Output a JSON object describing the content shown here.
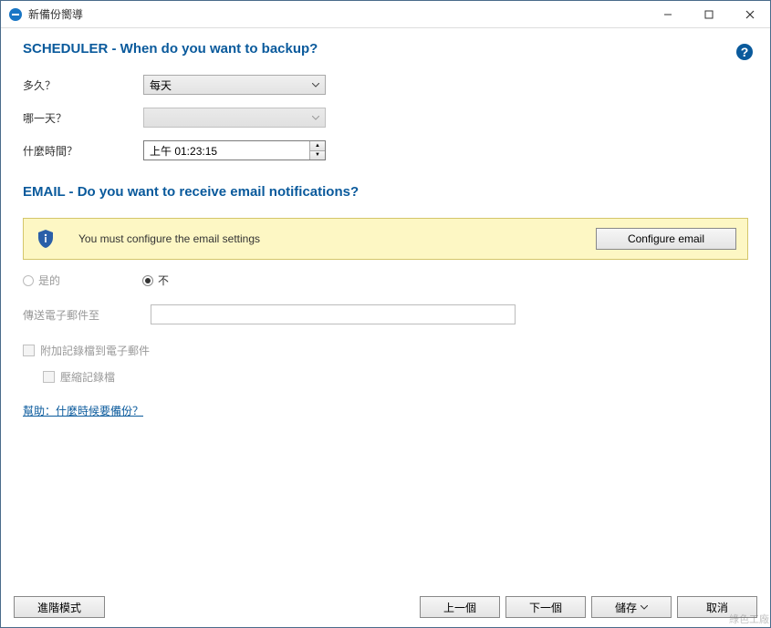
{
  "titlebar": {
    "title": "新備份嚮導"
  },
  "scheduler": {
    "heading": "SCHEDULER - When do you want to backup?",
    "freq_label": "多久？",
    "freq_value": "每天",
    "day_label": "哪一天？",
    "day_value": "",
    "time_label": "什麼時間？",
    "time_value": "上午 01:23:15"
  },
  "email": {
    "heading": "EMAIL - Do you want to receive email notifications?",
    "notice_text": "You must configure the email settings",
    "configure_btn": "Configure email",
    "radio_yes": "是的",
    "radio_no": "不",
    "send_to_label": "傳送電子郵件至",
    "send_to_value": "",
    "attach_log_label": "附加記錄檔到電子郵件",
    "compress_log_label": "壓縮記錄檔",
    "help_link": "幫助：什麼時候要備份？"
  },
  "footer": {
    "advanced": "進階模式",
    "prev": "上一個",
    "next": "下一個",
    "save": "儲存",
    "cancel": "取消"
  },
  "watermark": "綠色工廠"
}
